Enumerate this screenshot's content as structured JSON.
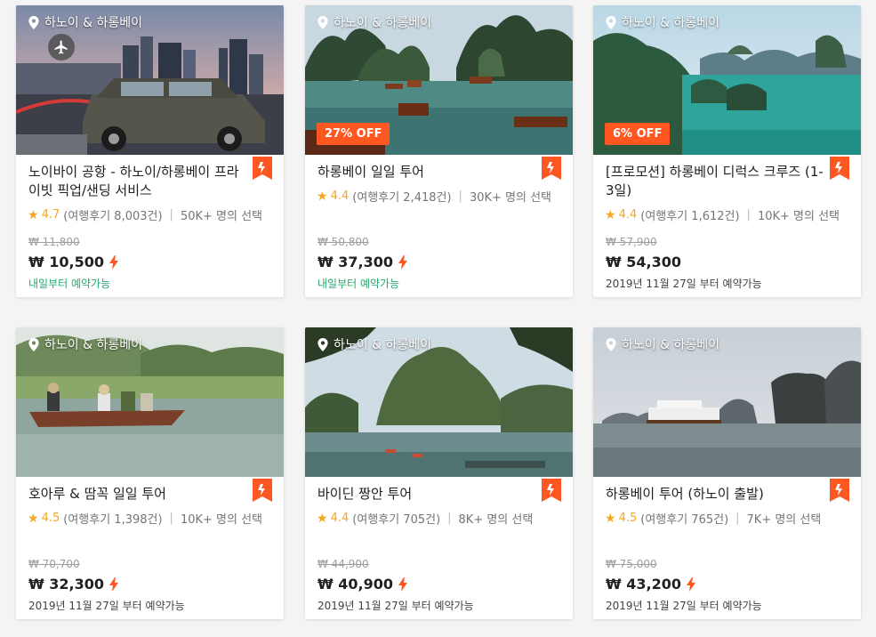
{
  "colors": {
    "accent": "#ff5722",
    "star": "#f5a623",
    "available_green": "#26a96c"
  },
  "cards": [
    {
      "location": "하노이 & 하롱베이",
      "title": "노이바이 공항 - 하노이/하롱베이 프라이빗 픽업/샌딩 서비스",
      "score": "4.7",
      "reviews": "(여행후기 8,003건)",
      "booked": "50K+ 명의 선택",
      "original_price": "₩ 11,800",
      "price": "₩ 10,500",
      "availability": "내일부터 예약가능",
      "discount": "",
      "icon": "plane-icon"
    },
    {
      "location": "하노이 & 하롱베이",
      "title": "하롱베이 일일 투어",
      "score": "4.4",
      "reviews": "(여행후기 2,418건)",
      "booked": "30K+ 명의 선택",
      "original_price": "₩ 50,800",
      "price": "₩ 37,300",
      "availability": "내일부터 예약가능",
      "discount": "27% OFF"
    },
    {
      "location": "하노이 & 하롱베이",
      "title": "[프로모션] 하롱베이 디럭스 크루즈 (1-3일)",
      "score": "4.4",
      "reviews": "(여행후기 1,612건)",
      "booked": "10K+ 명의 선택",
      "original_price": "₩ 57,900",
      "price": "₩ 54,300",
      "availability": "2019년 11월 27일 부터 예약가능",
      "discount": "6% OFF"
    },
    {
      "location": "하노이 & 하롱베이",
      "title": "호아루 & 땀꼭 일일 투어",
      "score": "4.5",
      "reviews": "(여행후기 1,398건)",
      "booked": "10K+ 명의 선택",
      "original_price": "₩ 70,700",
      "price": "₩ 32,300",
      "availability": "2019년 11월 27일 부터 예약가능",
      "discount": ""
    },
    {
      "location": "하노이 & 하롱베이",
      "title": "바이딘 짱안 투어",
      "score": "4.4",
      "reviews": "(여행후기 705건)",
      "booked": "8K+ 명의 선택",
      "original_price": "₩ 44,900",
      "price": "₩ 40,900",
      "availability": "2019년 11월 27일 부터 예약가능",
      "discount": ""
    },
    {
      "location": "하노이 & 하롱베이",
      "title": "하롱베이 투어 (하노이 출발)",
      "score": "4.5",
      "reviews": "(여행후기 765건)",
      "booked": "7K+ 명의 선택",
      "original_price": "₩ 75,000",
      "price": "₩ 43,200",
      "availability": "2019년 11월 27일 부터 예약가능",
      "discount": ""
    }
  ]
}
